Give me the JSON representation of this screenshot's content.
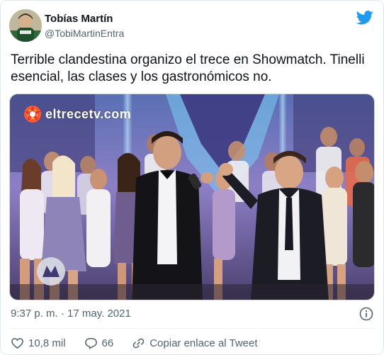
{
  "tweet": {
    "author_name": "Tobías Martín",
    "author_handle": "@TobiMartinEntra",
    "text": "Terrible clandestina organizo el trece en Showmatch. Tinelli esencial, las clases y los gastronómicos no.",
    "timestamp": "9:37 p. m. · 17 may. 2021"
  },
  "media": {
    "watermark": "eltrecetv.com"
  },
  "actions": {
    "likes": "10,8 mil",
    "replies": "66",
    "copy_link_label": "Copiar enlace al Tweet"
  },
  "colors": {
    "twitter_blue": "#1d9bf0",
    "secondary_text": "#536471"
  }
}
